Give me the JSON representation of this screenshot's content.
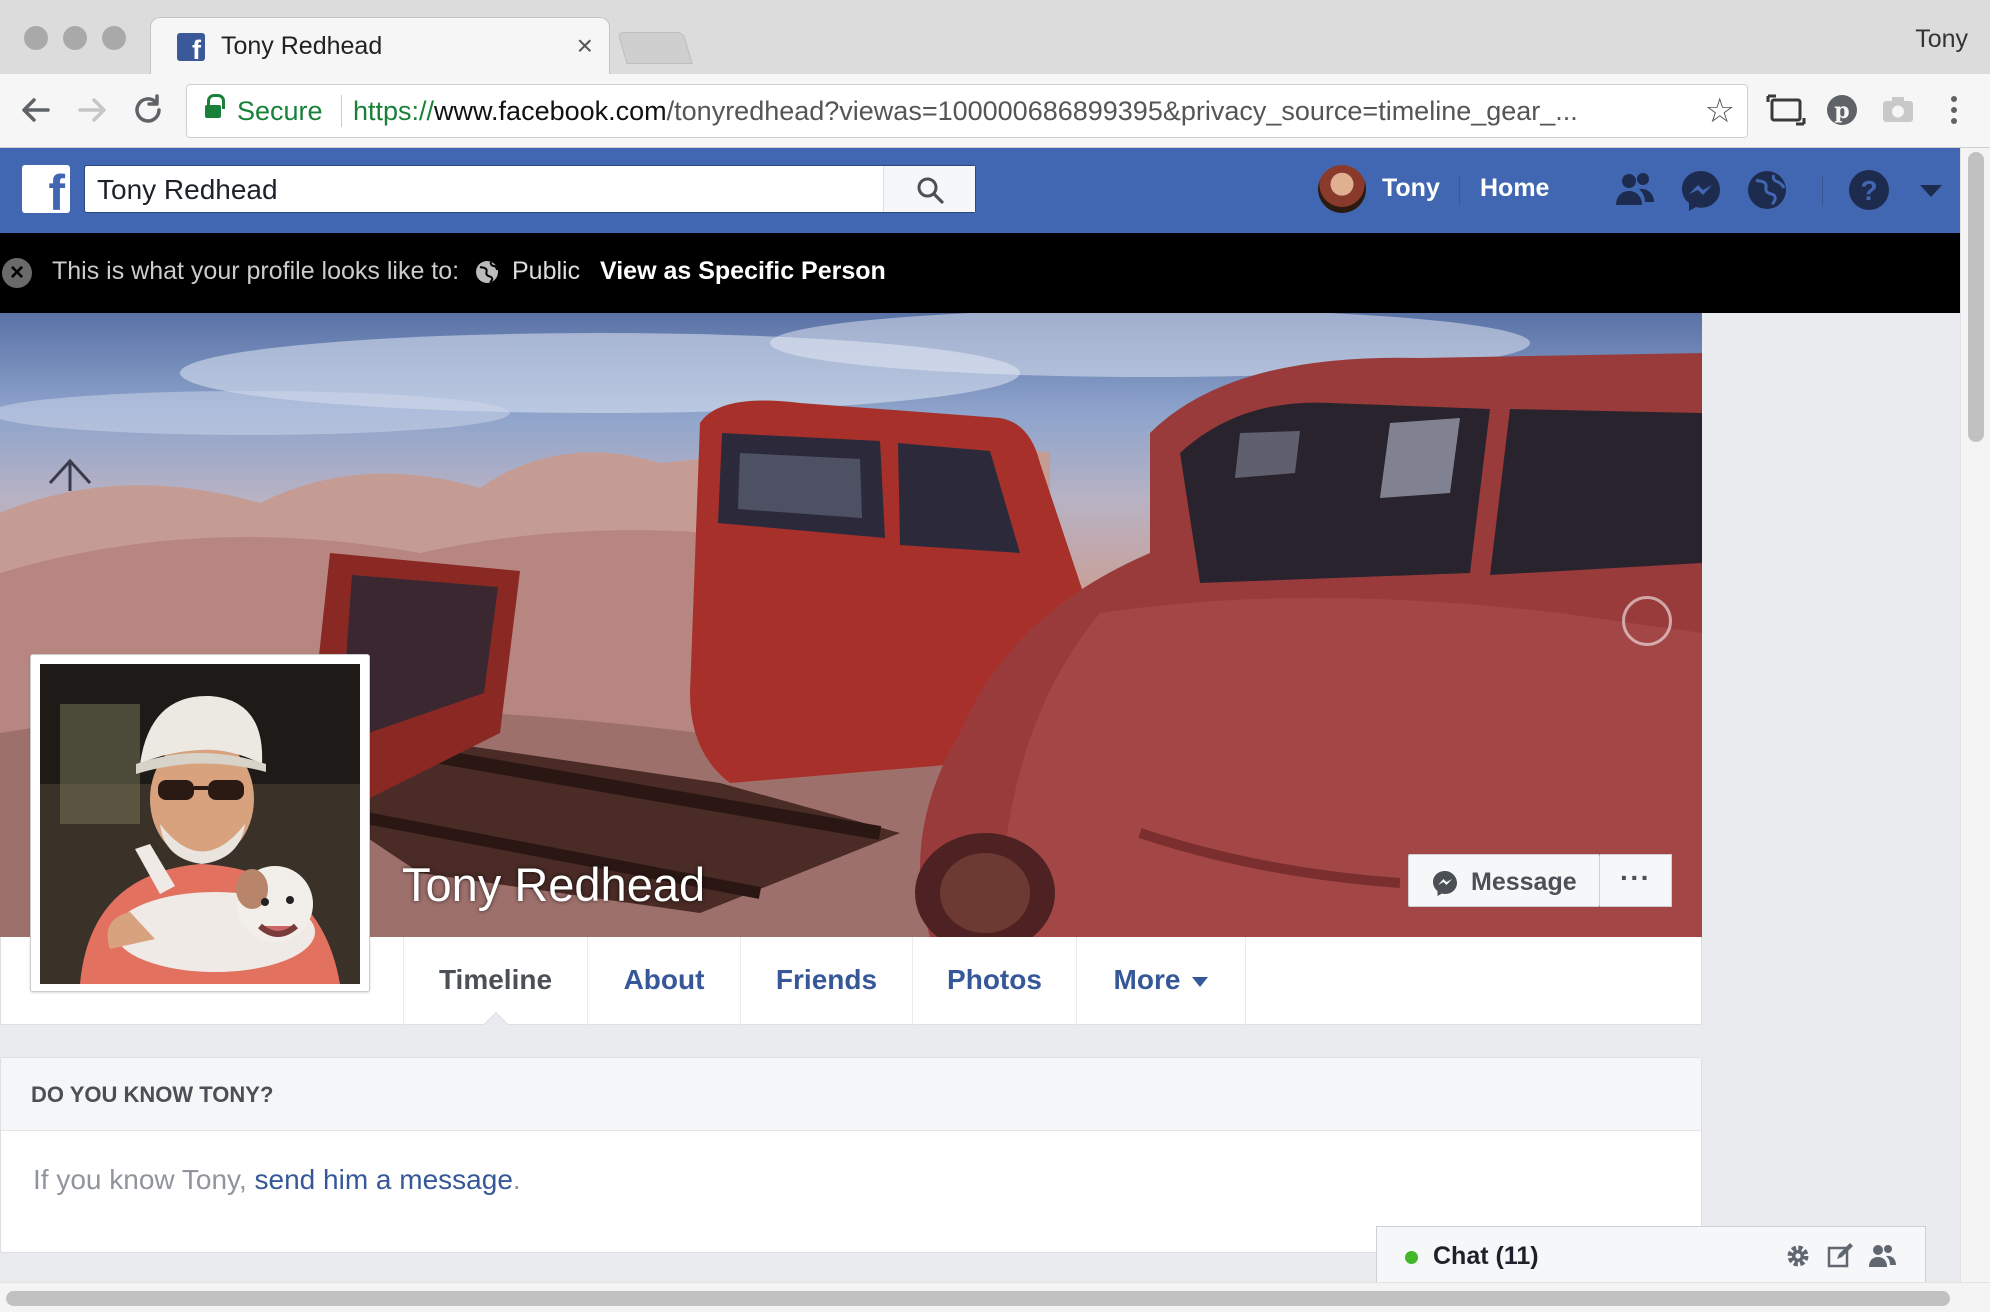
{
  "browser": {
    "tab_title": "Tony Redhead",
    "tab_close": "×",
    "profile_name": "Tony",
    "secure_label": "Secure",
    "url_scheme": "https://",
    "url_host": "www.facebook.com",
    "url_path": "/tonyredhead?viewas=100000686899395&privacy_source=timeline_gear_...",
    "back_icon": "back-arrow-icon",
    "forward_icon": "forward-arrow-icon",
    "reload_icon": "reload-icon",
    "bookmark_icon": "star-icon",
    "extension_icons": [
      "cast-screen-icon",
      "pinterest-icon",
      "camera-icon",
      "kebab-menu-icon"
    ]
  },
  "fb_nav": {
    "search_value": "Tony Redhead",
    "user_name": "Tony",
    "home_label": "Home",
    "icons": [
      "friend-requests-icon",
      "messenger-icon",
      "notifications-globe-icon",
      "help-icon",
      "account-caret-icon"
    ],
    "bar_color": "#4267b2"
  },
  "view_as": {
    "text": "This is what your profile looks like to:",
    "audience": "Public",
    "link": "View as Specific Person"
  },
  "profile": {
    "name": "Tony Redhead",
    "message_label": "Message",
    "more_label": "···"
  },
  "tabs": [
    {
      "label": "Timeline",
      "active": true
    },
    {
      "label": "About",
      "active": false
    },
    {
      "label": "Friends",
      "active": false
    },
    {
      "label": "Photos",
      "active": false
    },
    {
      "label": "More",
      "active": false
    }
  ],
  "know_card": {
    "title": "DO YOU KNOW TONY?",
    "body_prefix": "If you know Tony, ",
    "body_link": "send him a message",
    "body_suffix": "."
  },
  "chat": {
    "label": "Chat (11)",
    "status_color": "#42b72a",
    "icons": [
      "settings-gear-icon",
      "new-message-icon",
      "create-group-icon"
    ]
  }
}
